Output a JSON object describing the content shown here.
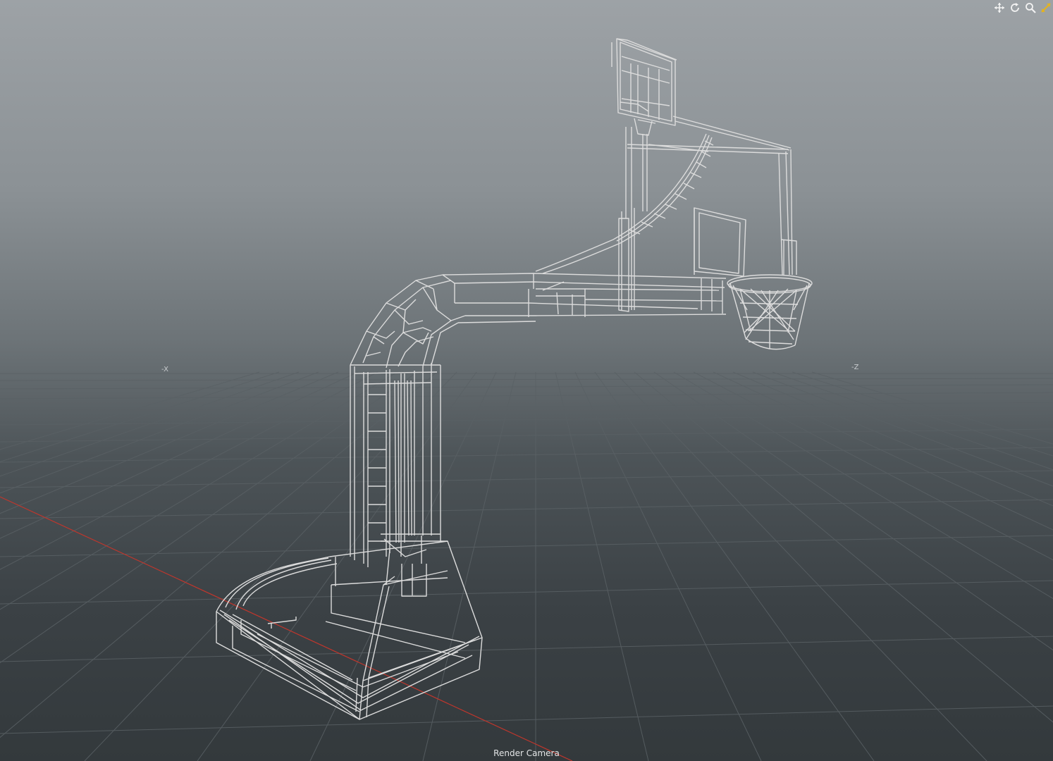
{
  "viewport": {
    "camera_label": "Render Camera",
    "axis_labels": {
      "neg_x": "-X",
      "neg_z": "-Z"
    },
    "background_top": "#9da2a6",
    "background_bottom": "#33393c",
    "grid_color": "#5a6165",
    "x_axis_color": "#c0362c",
    "wire_color": "#dcdcdc",
    "object": "basketball-hoop-wireframe"
  },
  "toolbar": {
    "tools": [
      {
        "name": "pan-tool",
        "icon": "move-arrows-icon"
      },
      {
        "name": "orbit-tool",
        "icon": "rotate-icon"
      },
      {
        "name": "zoom-tool",
        "icon": "magnifier-icon"
      },
      {
        "name": "maximize-tool",
        "icon": "expand-arrow-icon"
      }
    ],
    "highlight_color": "#e3b321"
  }
}
